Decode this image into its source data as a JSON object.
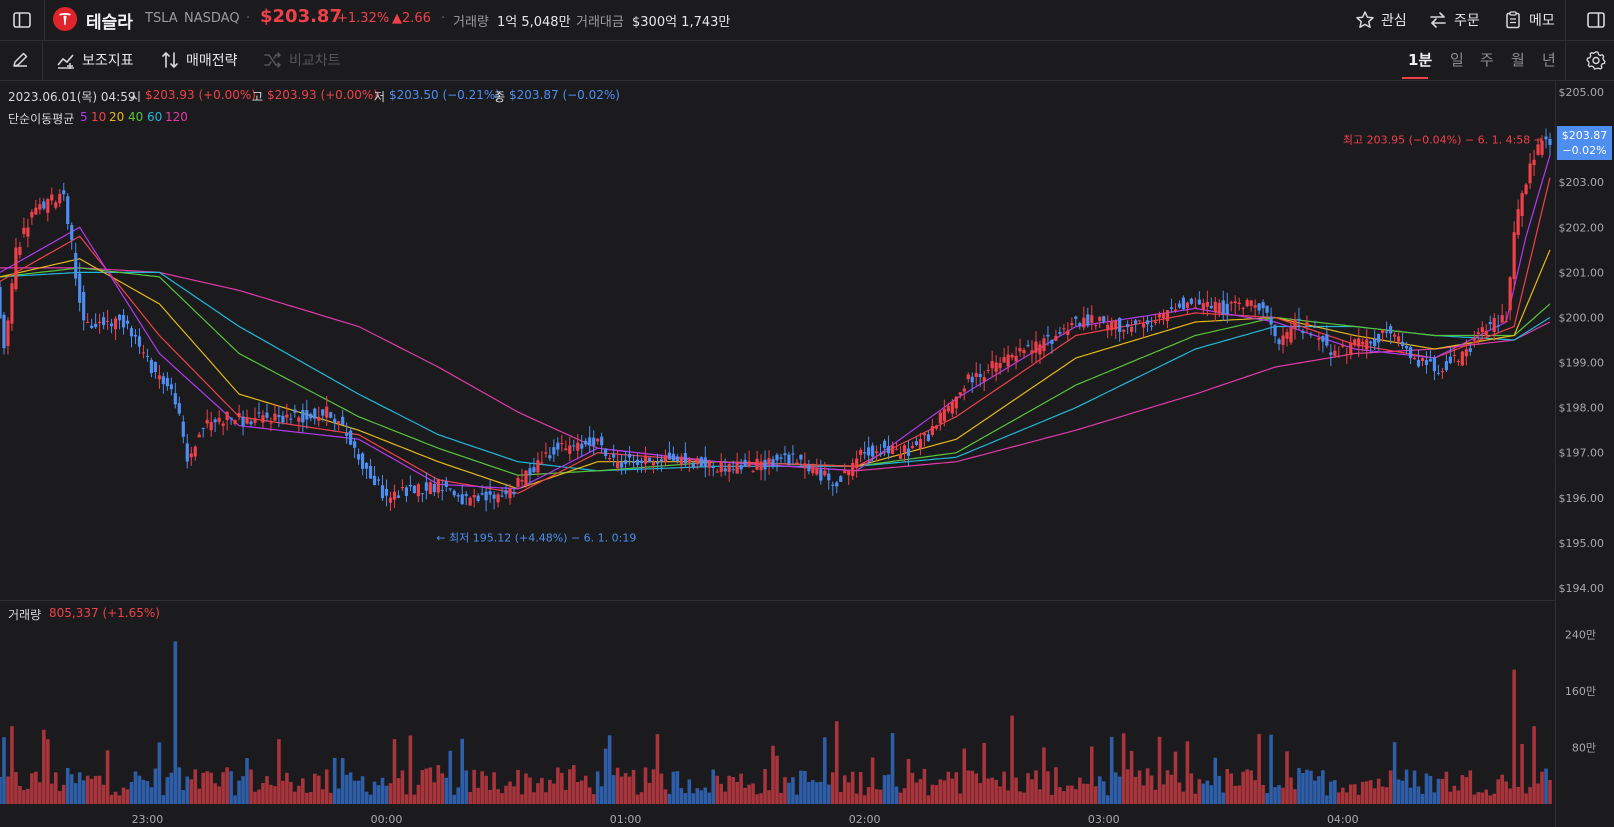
{
  "header": {
    "name": "테슬라",
    "symbol": "TSLA",
    "exchange": "NASDAQ",
    "separator": "·",
    "price": "$203.87",
    "change_pct": "+1.32%",
    "change_abs": "▲2.66",
    "volume_label": "거래량",
    "volume_value": "1억 5,048만",
    "turnover_label": "거래대금",
    "turnover_value": "$300억 1,743만",
    "watch_label": "관심",
    "order_label": "주문",
    "memo_label": "메모"
  },
  "toolbar": {
    "indicators_label": "보조지표",
    "strategy_label": "매매전략",
    "compare_label": "비교차트",
    "periods": [
      "1분",
      "일",
      "주",
      "월",
      "년"
    ],
    "active_period": "1분"
  },
  "info": {
    "datetime": "2023.06.01(목) 04:59",
    "open_label": "시",
    "open_value": "$203.93 (+0.00%)",
    "high_label": "고",
    "high_value": "$203.93 (+0.00%)",
    "low_label": "저",
    "low_value": "$203.50 (−0.21%)",
    "close_label": "종",
    "close_value": "$203.87 (−0.02%)",
    "ma_label": "단순이동평균",
    "ma_periods": [
      "5",
      "10",
      "20",
      "40",
      "60",
      "120"
    ]
  },
  "price_tag": {
    "price": "$203.87",
    "pct": "−0.02%"
  },
  "volume_info": {
    "label": "거래량",
    "value": "805,337 (+1.65%)"
  },
  "colors": {
    "up": "#f0404a",
    "down": "#4d8ef0",
    "ma5": "#b23aee",
    "ma10": "#f0404a",
    "ma20": "#e5b815",
    "ma40": "#58c43a",
    "ma60": "#20b8d8",
    "ma120": "#e23aa8",
    "vol_up": "#a8343c",
    "vol_down": "#2e5ea8"
  },
  "chart_data": {
    "type": "candlestick",
    "title": "",
    "ylim": [
      194.0,
      205.0
    ],
    "y_ticks": [
      "$205.00",
      "$204.00",
      "$203.00",
      "$202.00",
      "$201.00",
      "$200.00",
      "$199.00",
      "$198.00",
      "$197.00",
      "$196.00",
      "$195.00",
      "$194.00"
    ],
    "x_ticks": [
      "23:00",
      "00:00",
      "01:00",
      "02:00",
      "03:00",
      "04:00"
    ],
    "x_tick_minutes": [
      37,
      97,
      157,
      217,
      277,
      337
    ],
    "time_range_minutes": [
      0,
      389
    ],
    "price_path": [
      [
        0,
        200.8
      ],
      [
        2,
        199.2
      ],
      [
        5,
        201.5
      ],
      [
        9,
        202.3
      ],
      [
        14,
        202.6
      ],
      [
        17,
        202.8
      ],
      [
        20,
        201.0
      ],
      [
        22,
        199.8
      ],
      [
        28,
        199.9
      ],
      [
        33,
        199.9
      ],
      [
        38,
        199.0
      ],
      [
        42,
        198.6
      ],
      [
        45,
        198.2
      ],
      [
        48,
        196.8
      ],
      [
        52,
        197.6
      ],
      [
        58,
        197.8
      ],
      [
        63,
        197.7
      ],
      [
        70,
        197.8
      ],
      [
        78,
        197.8
      ],
      [
        84,
        197.9
      ],
      [
        88,
        197.4
      ],
      [
        93,
        196.6
      ],
      [
        98,
        196.0
      ],
      [
        105,
        196.2
      ],
      [
        112,
        196.3
      ],
      [
        118,
        195.9
      ],
      [
        124,
        196.0
      ],
      [
        130,
        196.2
      ],
      [
        136,
        196.8
      ],
      [
        140,
        197.1
      ],
      [
        146,
        197.1
      ],
      [
        150,
        197.3
      ],
      [
        155,
        196.8
      ],
      [
        162,
        196.8
      ],
      [
        168,
        196.9
      ],
      [
        174,
        196.8
      ],
      [
        180,
        196.7
      ],
      [
        190,
        196.7
      ],
      [
        198,
        196.9
      ],
      [
        204,
        196.7
      ],
      [
        209,
        196.4
      ],
      [
        212,
        196.4
      ],
      [
        216,
        196.9
      ],
      [
        222,
        197.1
      ],
      [
        226,
        197.0
      ],
      [
        230,
        197.1
      ],
      [
        234,
        197.4
      ],
      [
        238,
        197.9
      ],
      [
        244,
        198.6
      ],
      [
        250,
        198.9
      ],
      [
        256,
        199.2
      ],
      [
        260,
        199.3
      ],
      [
        266,
        199.6
      ],
      [
        270,
        199.9
      ],
      [
        276,
        199.9
      ],
      [
        282,
        199.8
      ],
      [
        290,
        199.8
      ],
      [
        296,
        200.3
      ],
      [
        302,
        200.3
      ],
      [
        308,
        200.2
      ],
      [
        314,
        200.3
      ],
      [
        318,
        200.3
      ],
      [
        322,
        199.3
      ],
      [
        326,
        199.9
      ],
      [
        332,
        199.6
      ],
      [
        336,
        199.2
      ],
      [
        342,
        199.4
      ],
      [
        346,
        199.5
      ],
      [
        350,
        199.7
      ],
      [
        354,
        199.2
      ],
      [
        358,
        199.0
      ],
      [
        362,
        198.9
      ],
      [
        368,
        199.1
      ],
      [
        372,
        199.6
      ],
      [
        376,
        199.9
      ],
      [
        379,
        200.0
      ],
      [
        381,
        202.0
      ],
      [
        384,
        203.0
      ],
      [
        386,
        203.6
      ],
      [
        388,
        203.9
      ],
      [
        389,
        203.87
      ]
    ],
    "series": [
      {
        "name": "5",
        "values": [
          [
            0,
            201.0
          ],
          [
            20,
            202.0
          ],
          [
            40,
            199.2
          ],
          [
            60,
            197.6
          ],
          [
            90,
            197.3
          ],
          [
            110,
            196.3
          ],
          [
            130,
            196.2
          ],
          [
            150,
            197.1
          ],
          [
            180,
            196.8
          ],
          [
            215,
            196.6
          ],
          [
            240,
            198.2
          ],
          [
            270,
            199.8
          ],
          [
            300,
            200.2
          ],
          [
            320,
            199.9
          ],
          [
            340,
            199.3
          ],
          [
            360,
            199.1
          ],
          [
            378,
            199.9
          ],
          [
            383,
            201.8
          ],
          [
            389,
            203.6
          ]
        ]
      },
      {
        "name": "10",
        "values": [
          [
            0,
            200.8
          ],
          [
            20,
            201.8
          ],
          [
            40,
            199.6
          ],
          [
            60,
            197.8
          ],
          [
            90,
            197.4
          ],
          [
            110,
            196.4
          ],
          [
            130,
            196.1
          ],
          [
            150,
            197.0
          ],
          [
            180,
            196.8
          ],
          [
            215,
            196.7
          ],
          [
            240,
            197.8
          ],
          [
            270,
            199.6
          ],
          [
            300,
            200.1
          ],
          [
            320,
            200.0
          ],
          [
            340,
            199.4
          ],
          [
            360,
            199.1
          ],
          [
            380,
            199.8
          ],
          [
            389,
            203.1
          ]
        ]
      },
      {
        "name": "20",
        "values": [
          [
            0,
            200.9
          ],
          [
            20,
            201.3
          ],
          [
            40,
            200.3
          ],
          [
            60,
            198.3
          ],
          [
            90,
            197.5
          ],
          [
            110,
            196.8
          ],
          [
            130,
            196.2
          ],
          [
            150,
            196.8
          ],
          [
            180,
            196.8
          ],
          [
            215,
            196.7
          ],
          [
            240,
            197.3
          ],
          [
            270,
            199.1
          ],
          [
            300,
            199.9
          ],
          [
            320,
            200.0
          ],
          [
            340,
            199.6
          ],
          [
            360,
            199.3
          ],
          [
            380,
            199.6
          ],
          [
            389,
            201.5
          ]
        ]
      },
      {
        "name": "40",
        "values": [
          [
            0,
            200.9
          ],
          [
            20,
            201.1
          ],
          [
            40,
            200.9
          ],
          [
            60,
            199.2
          ],
          [
            90,
            197.8
          ],
          [
            110,
            197.1
          ],
          [
            130,
            196.5
          ],
          [
            150,
            196.6
          ],
          [
            180,
            196.8
          ],
          [
            215,
            196.7
          ],
          [
            240,
            197.0
          ],
          [
            270,
            198.5
          ],
          [
            300,
            199.6
          ],
          [
            320,
            200.0
          ],
          [
            340,
            199.8
          ],
          [
            360,
            199.6
          ],
          [
            380,
            199.6
          ],
          [
            389,
            200.3
          ]
        ]
      },
      {
        "name": "60",
        "values": [
          [
            0,
            200.9
          ],
          [
            20,
            201.0
          ],
          [
            40,
            201.0
          ],
          [
            60,
            199.8
          ],
          [
            90,
            198.3
          ],
          [
            110,
            197.4
          ],
          [
            130,
            196.8
          ],
          [
            150,
            196.6
          ],
          [
            180,
            196.7
          ],
          [
            215,
            196.7
          ],
          [
            240,
            196.9
          ],
          [
            270,
            198.0
          ],
          [
            300,
            199.3
          ],
          [
            320,
            199.8
          ],
          [
            340,
            199.8
          ],
          [
            360,
            199.6
          ],
          [
            380,
            199.5
          ],
          [
            389,
            200.0
          ]
        ]
      },
      {
        "name": "120",
        "values": [
          [
            0,
            201.1
          ],
          [
            20,
            201.1
          ],
          [
            40,
            201.0
          ],
          [
            60,
            200.6
          ],
          [
            90,
            199.8
          ],
          [
            110,
            198.9
          ],
          [
            130,
            197.9
          ],
          [
            150,
            197.1
          ],
          [
            180,
            196.8
          ],
          [
            215,
            196.6
          ],
          [
            240,
            196.8
          ],
          [
            270,
            197.5
          ],
          [
            300,
            198.3
          ],
          [
            320,
            198.9
          ],
          [
            340,
            199.2
          ],
          [
            360,
            199.3
          ],
          [
            380,
            199.5
          ],
          [
            389,
            199.9
          ]
        ]
      }
    ],
    "volume": {
      "ylim": [
        0,
        280
      ],
      "y_ticks": [
        "240만",
        "160만",
        "80만"
      ],
      "y_tick_values": [
        240,
        160,
        80
      ],
      "unit": "만",
      "spikes": [
        [
          3,
          110
        ],
        [
          11,
          105
        ],
        [
          44,
          230
        ],
        [
          62,
          65
        ],
        [
          86,
          65
        ],
        [
          110,
          55
        ],
        [
          144,
          55
        ],
        [
          180,
          40
        ],
        [
          240,
          45
        ],
        [
          254,
          125
        ],
        [
          279,
          95
        ],
        [
          284,
          75
        ],
        [
          319,
          98
        ],
        [
          380,
          190
        ],
        [
          385,
          110
        ]
      ]
    },
    "annotations": [
      {
        "text": "최고 203.95 (−0.04%) − 6. 1. 4:58 →",
        "minute": 388,
        "price": 203.95
      },
      {
        "text": "← 최저 195.12 (+4.48%) − 6. 1. 0:19",
        "minute": 110,
        "price": 195.12
      }
    ]
  }
}
